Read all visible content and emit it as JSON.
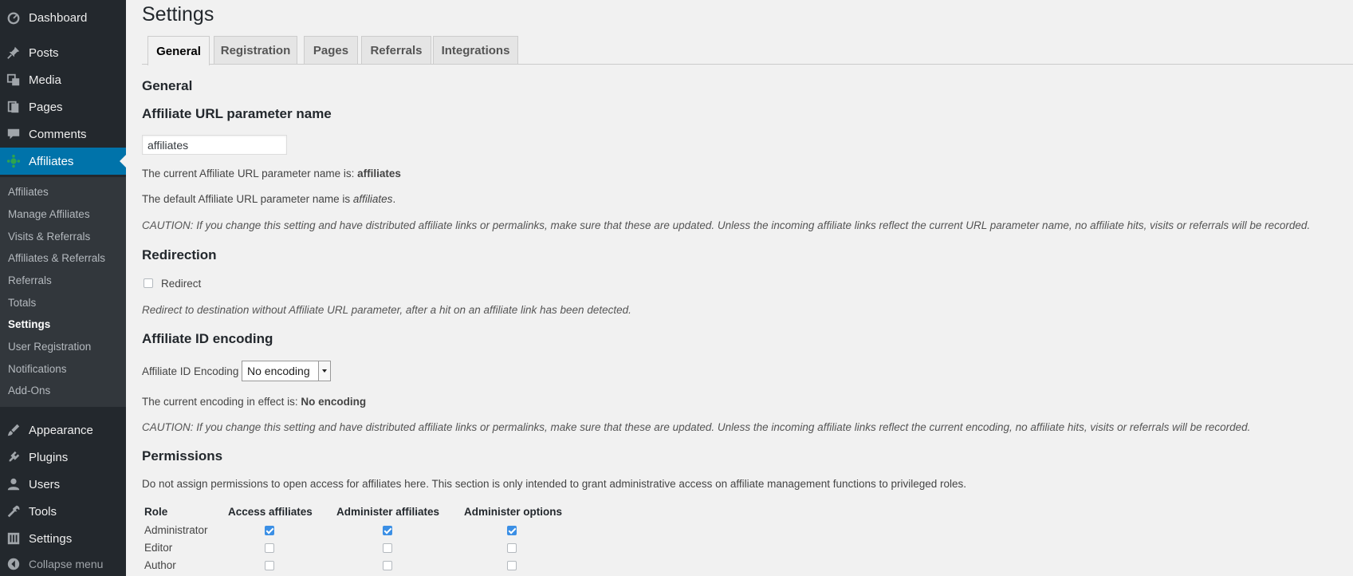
{
  "sidebar": {
    "top_items": [
      {
        "label": "Dashboard",
        "icon": "dashboard-icon"
      },
      {
        "label": "Posts",
        "icon": "pin-icon"
      },
      {
        "label": "Media",
        "icon": "media-icon"
      },
      {
        "label": "Pages",
        "icon": "pages-icon"
      },
      {
        "label": "Comments",
        "icon": "comment-icon"
      },
      {
        "label": "Affiliates",
        "icon": "affiliates-icon"
      }
    ],
    "submenu": [
      {
        "label": "Affiliates"
      },
      {
        "label": "Manage Affiliates"
      },
      {
        "label": "Visits & Referrals"
      },
      {
        "label": "Affiliates & Referrals"
      },
      {
        "label": "Referrals"
      },
      {
        "label": "Totals"
      },
      {
        "label": "Settings"
      },
      {
        "label": "User Registration"
      },
      {
        "label": "Notifications"
      },
      {
        "label": "Add-Ons"
      }
    ],
    "bottom_items": [
      {
        "label": "Appearance",
        "icon": "brush-icon"
      },
      {
        "label": "Plugins",
        "icon": "plugin-icon"
      },
      {
        "label": "Users",
        "icon": "user-icon"
      },
      {
        "label": "Tools",
        "icon": "wrench-icon"
      },
      {
        "label": "Settings",
        "icon": "settings-icon"
      }
    ],
    "collapse_label": "Collapse menu"
  },
  "page": {
    "title": "Settings",
    "tabs": [
      "General",
      "Registration",
      "Pages",
      "Referrals",
      "Integrations"
    ],
    "section_title": "General",
    "url_param": {
      "heading": "Affiliate URL parameter name",
      "input_value": "affiliates",
      "current_prefix": "The current Affiliate URL parameter name is:",
      "current_value": "affiliates",
      "default_prefix": "The default Affiliate URL parameter name is",
      "default_value": "affiliates",
      "default_suffix": ".",
      "caution": "CAUTION: If you change this setting and have distributed affiliate links or permalinks, make sure that these are updated. Unless the incoming affiliate links reflect the current URL parameter name, no affiliate hits, visits or referrals will be recorded."
    },
    "redirection": {
      "heading": "Redirection",
      "checkbox_label": "Redirect",
      "description": "Redirect to destination without Affiliate URL parameter, after a hit on an affiliate link has been detected."
    },
    "encoding": {
      "heading": "Affiliate ID encoding",
      "label": "Affiliate ID Encoding",
      "selected": "No encoding",
      "current_prefix": "The current encoding in effect is:",
      "current_value": "No encoding",
      "caution": "CAUTION: If you change this setting and have distributed affiliate links or permalinks, make sure that these are updated. Unless the incoming affiliate links reflect the current encoding, no affiliate hits, visits or referrals will be recorded."
    },
    "permissions": {
      "heading": "Permissions",
      "description": "Do not assign permissions to open access for affiliates here. This section is only intended to grant administrative access on affiliate management functions to privileged roles.",
      "columns": [
        "Role",
        "Access affiliates",
        "Administer affiliates",
        "Administer options"
      ],
      "rows": [
        {
          "role": "Administrator"
        },
        {
          "role": "Editor"
        },
        {
          "role": "Author"
        }
      ]
    }
  },
  "colors": {
    "sidebar_bg": "#23282d",
    "submenu_bg": "#32373c",
    "accent": "#0073aa",
    "checkbox_checked": "#3b8fe5",
    "affiliates_icon": "#2ea44f"
  }
}
